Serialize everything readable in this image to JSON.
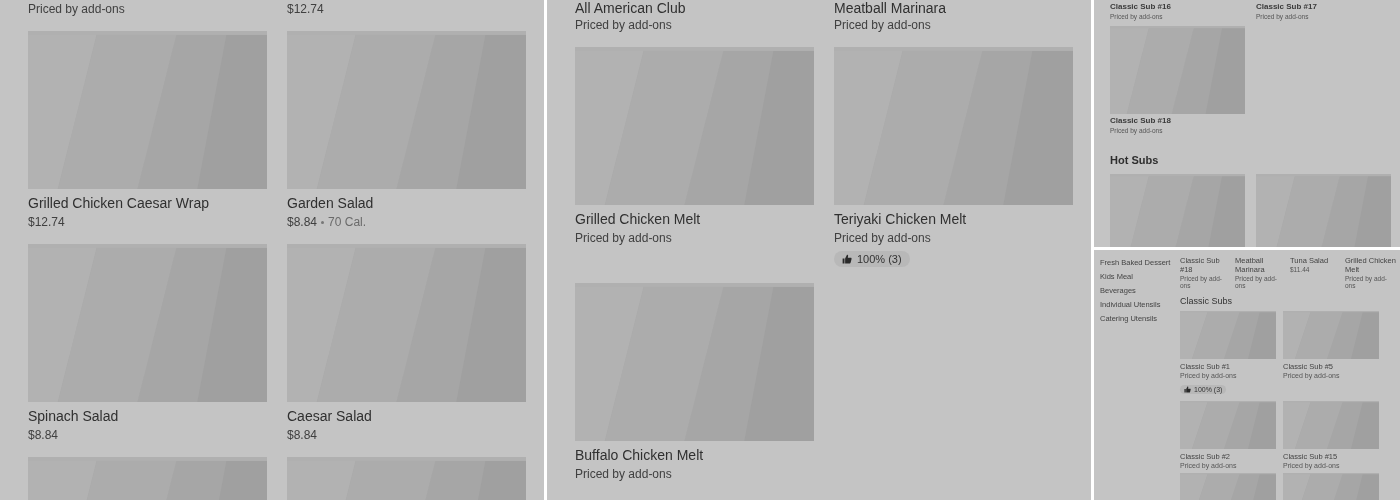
{
  "panels": [
    {
      "kind": "wide",
      "sections": [
        {
          "kind": "grid",
          "items": [
            {
              "price": "Priced by add-ons"
            },
            {
              "price": "$12.74"
            },
            {
              "image": true,
              "name": "Grilled Chicken Caesar Wrap",
              "price": "$12.74"
            },
            {
              "image": true,
              "name": "Garden Salad",
              "price": "$8.84",
              "calories": "70 Cal."
            },
            {
              "image": true,
              "name": "Spinach Salad",
              "price": "$8.84"
            },
            {
              "image": true,
              "name": "Caesar Salad",
              "price": "$8.84"
            },
            {
              "image": true
            },
            {
              "image": true
            }
          ]
        }
      ]
    },
    {
      "kind": "wide",
      "sections": [
        {
          "kind": "grid",
          "items": [
            {
              "name": "All American Club",
              "price": "Priced by add-ons"
            },
            {
              "name": "Meatball Marinara",
              "price": "Priced by add-ons"
            },
            {
              "image": true,
              "name": "Grilled Chicken Melt",
              "price": "Priced by add-ons"
            },
            {
              "image": true,
              "name": "Teriyaki Chicken Melt",
              "price": "Priced by add-ons",
              "rating": "100% (3)"
            },
            {
              "image": true,
              "name": "Buffalo Chicken Melt",
              "price": "Priced by add-ons"
            }
          ]
        }
      ]
    },
    {
      "kind": "narrow",
      "sections": [
        {
          "kind": "grid",
          "items": [
            {
              "name": "Classic Sub #16",
              "price": "Priced by add-ons"
            },
            {
              "name": "Classic Sub #17",
              "price": "Priced by add-ons"
            },
            {
              "image": true,
              "name": "Classic Sub #18",
              "price": "Priced by add-ons"
            }
          ]
        },
        {
          "kind": "grid",
          "heading": "Hot Subs",
          "items": [
            {
              "image": true
            },
            {
              "image": true
            }
          ]
        }
      ]
    },
    {
      "kind": "tiny",
      "sidebar": [
        "Fresh Baked Dessert",
        "Kids Meal",
        "Beverages",
        "Individual Utensils",
        "Catering Utensils"
      ],
      "sections": [
        {
          "kind": "strip",
          "items": [
            {
              "name": "Classic Sub #18",
              "price": "Priced by add-ons"
            },
            {
              "name": "Meatball Marinara",
              "price": "Priced by add-ons"
            },
            {
              "name": "Tuna Salad",
              "price": "$11.44"
            },
            {
              "name": "Grilled Chicken Melt",
              "price": "Priced by add-ons"
            }
          ]
        },
        {
          "kind": "grid",
          "heading": "Classic Subs",
          "items": [
            {
              "image": true,
              "name": "Classic Sub #1",
              "price": "Priced by add-ons",
              "rating": "100% (3)"
            },
            {
              "image": true,
              "name": "Classic Sub #5",
              "price": "Priced by add-ons"
            },
            {
              "image": true,
              "name": "Classic Sub #2",
              "price": "Priced by add-ons"
            },
            {
              "image": true,
              "name": "Classic Sub #15",
              "price": "Priced by add-ons"
            },
            {
              "image": true
            },
            {
              "image": true
            }
          ]
        }
      ]
    }
  ]
}
